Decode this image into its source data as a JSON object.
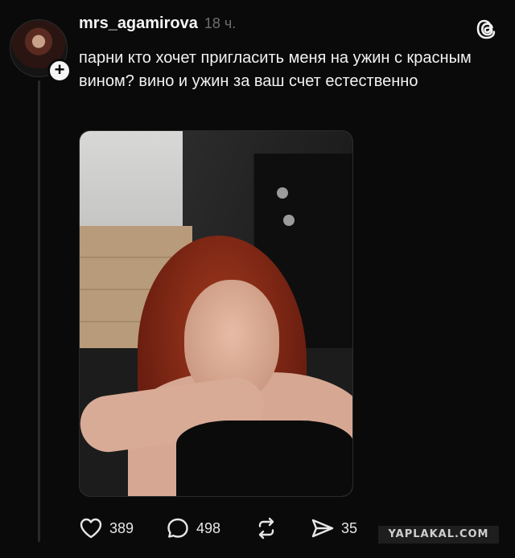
{
  "post": {
    "username": "mrs_agamirova",
    "time": "18 ч.",
    "text": "парни кто хочет пригласить меня на ужин с красным вином? вино и ужин за ваш счет естественно"
  },
  "actions": {
    "likes": "389",
    "comments": "498",
    "shares": "35"
  },
  "watermark": "YAPLAKAL.COM",
  "icons": {
    "avatar_plus": "+",
    "like": "heart-icon",
    "comment": "comment-icon",
    "repost": "repost-icon",
    "share": "share-icon",
    "app": "threads-logo-icon"
  }
}
